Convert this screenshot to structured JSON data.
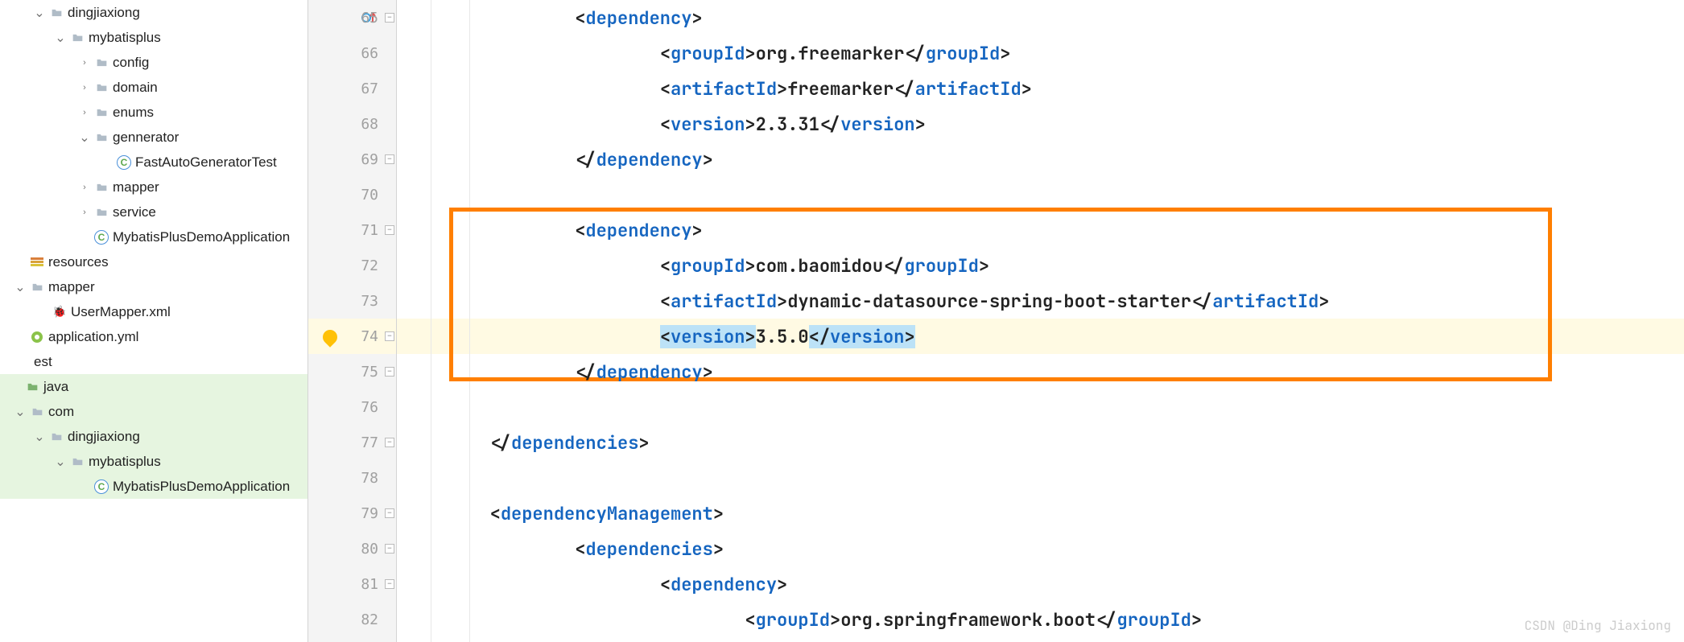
{
  "tree": {
    "items": [
      {
        "indent": 24,
        "arrow": "down",
        "icon": "folder",
        "label": "dingjiaxiong"
      },
      {
        "indent": 50,
        "arrow": "down",
        "icon": "folder",
        "label": "mybatisplus"
      },
      {
        "indent": 80,
        "arrow": "right",
        "icon": "folder",
        "label": "config"
      },
      {
        "indent": 80,
        "arrow": "right",
        "icon": "folder",
        "label": "domain"
      },
      {
        "indent": 80,
        "arrow": "right",
        "icon": "folder",
        "label": "enums"
      },
      {
        "indent": 80,
        "arrow": "down",
        "icon": "folder",
        "label": "gennerator"
      },
      {
        "indent": 108,
        "arrow": "",
        "icon": "java",
        "label": "FastAutoGeneratorTest"
      },
      {
        "indent": 80,
        "arrow": "right",
        "icon": "folder",
        "label": "mapper"
      },
      {
        "indent": 80,
        "arrow": "right",
        "icon": "folder",
        "label": "service"
      },
      {
        "indent": 80,
        "arrow": "",
        "icon": "java",
        "label": "MybatisPlusDemoApplication"
      },
      {
        "indent": 0,
        "arrow": "",
        "icon": "res",
        "label": "resources"
      },
      {
        "indent": 0,
        "arrow": "down",
        "icon": "folder",
        "label": "mapper"
      },
      {
        "indent": 28,
        "arrow": "",
        "icon": "xml",
        "label": "UserMapper.xml"
      },
      {
        "indent": 0,
        "arrow": "",
        "icon": "yml",
        "label": "application.yml"
      },
      {
        "indent": -18,
        "arrow": "",
        "icon": "",
        "label": "est"
      },
      {
        "indent": -6,
        "arrow": "",
        "icon": "folder-g",
        "label": "java",
        "hl": true
      },
      {
        "indent": 0,
        "arrow": "down",
        "icon": "folder",
        "label": "com",
        "hl": true
      },
      {
        "indent": 24,
        "arrow": "down",
        "icon": "folder",
        "label": "dingjiaxiong",
        "hl": true
      },
      {
        "indent": 50,
        "arrow": "down",
        "icon": "folder",
        "label": "mybatisplus",
        "hl": true
      },
      {
        "indent": 80,
        "arrow": "",
        "icon": "java",
        "label": "MybatisPlusDemoApplication",
        "hl": true
      }
    ]
  },
  "gutter": {
    "lines": [
      "65",
      "66",
      "67",
      "68",
      "69",
      "70",
      "71",
      "72",
      "73",
      "74",
      "75",
      "76",
      "77",
      "78",
      "79",
      "80",
      "81",
      "82"
    ]
  },
  "code": {
    "lines": [
      {
        "indent": 4,
        "parts": [
          {
            "t": "<",
            "c": "punct"
          },
          {
            "t": "dependency",
            "c": "tag"
          },
          {
            "t": ">",
            "c": "punct"
          }
        ]
      },
      {
        "indent": 6,
        "parts": [
          {
            "t": "<",
            "c": "punct"
          },
          {
            "t": "groupId",
            "c": "tag"
          },
          {
            "t": ">",
            "c": "punct"
          },
          {
            "t": "org.freemarker",
            "c": "text"
          },
          {
            "t": "</",
            "c": "punct"
          },
          {
            "t": "groupId",
            "c": "tag"
          },
          {
            "t": ">",
            "c": "punct"
          }
        ]
      },
      {
        "indent": 6,
        "parts": [
          {
            "t": "<",
            "c": "punct"
          },
          {
            "t": "artifactId",
            "c": "tag"
          },
          {
            "t": ">",
            "c": "punct"
          },
          {
            "t": "freemarker",
            "c": "text"
          },
          {
            "t": "</",
            "c": "punct"
          },
          {
            "t": "artifactId",
            "c": "tag"
          },
          {
            "t": ">",
            "c": "punct"
          }
        ]
      },
      {
        "indent": 6,
        "parts": [
          {
            "t": "<",
            "c": "punct"
          },
          {
            "t": "version",
            "c": "tag"
          },
          {
            "t": ">",
            "c": "punct"
          },
          {
            "t": "2.3.31",
            "c": "text"
          },
          {
            "t": "</",
            "c": "punct"
          },
          {
            "t": "version",
            "c": "tag"
          },
          {
            "t": ">",
            "c": "punct"
          }
        ]
      },
      {
        "indent": 4,
        "parts": [
          {
            "t": "</",
            "c": "punct"
          },
          {
            "t": "dependency",
            "c": "tag"
          },
          {
            "t": ">",
            "c": "punct"
          }
        ]
      },
      {
        "indent": 0,
        "parts": []
      },
      {
        "indent": 4,
        "parts": [
          {
            "t": "<",
            "c": "punct"
          },
          {
            "t": "dependency",
            "c": "tag"
          },
          {
            "t": ">",
            "c": "punct"
          }
        ]
      },
      {
        "indent": 6,
        "parts": [
          {
            "t": "<",
            "c": "punct"
          },
          {
            "t": "groupId",
            "c": "tag"
          },
          {
            "t": ">",
            "c": "punct"
          },
          {
            "t": "com.baomidou",
            "c": "text"
          },
          {
            "t": "</",
            "c": "punct"
          },
          {
            "t": "groupId",
            "c": "tag"
          },
          {
            "t": ">",
            "c": "punct"
          }
        ]
      },
      {
        "indent": 6,
        "parts": [
          {
            "t": "<",
            "c": "punct"
          },
          {
            "t": "artifactId",
            "c": "tag"
          },
          {
            "t": ">",
            "c": "punct"
          },
          {
            "t": "dynamic-datasource-spring-boot-starter",
            "c": "text"
          },
          {
            "t": "</",
            "c": "punct"
          },
          {
            "t": "artifactId",
            "c": "tag"
          },
          {
            "t": ">",
            "c": "punct"
          }
        ]
      },
      {
        "indent": 6,
        "parts": [
          {
            "t": "<",
            "c": "punct sel"
          },
          {
            "t": "version",
            "c": "tag sel"
          },
          {
            "t": ">",
            "c": "punct sel"
          },
          {
            "t": "3.5.0",
            "c": "text"
          },
          {
            "t": "<",
            "c": "punct sel"
          },
          {
            "t": "/",
            "c": "punct sel"
          },
          {
            "t": "version",
            "c": "tag sel"
          },
          {
            "t": ">",
            "c": "punct sel"
          }
        ],
        "current": true
      },
      {
        "indent": 4,
        "parts": [
          {
            "t": "</",
            "c": "punct"
          },
          {
            "t": "dependency",
            "c": "tag"
          },
          {
            "t": ">",
            "c": "punct"
          }
        ]
      },
      {
        "indent": 0,
        "parts": []
      },
      {
        "indent": 2,
        "parts": [
          {
            "t": "</",
            "c": "punct"
          },
          {
            "t": "dependencies",
            "c": "tag"
          },
          {
            "t": ">",
            "c": "punct"
          }
        ]
      },
      {
        "indent": 0,
        "parts": []
      },
      {
        "indent": 2,
        "parts": [
          {
            "t": "<",
            "c": "punct"
          },
          {
            "t": "dependencyManagement",
            "c": "tag"
          },
          {
            "t": ">",
            "c": "punct"
          }
        ]
      },
      {
        "indent": 4,
        "parts": [
          {
            "t": "<",
            "c": "punct"
          },
          {
            "t": "dependencies",
            "c": "tag"
          },
          {
            "t": ">",
            "c": "punct"
          }
        ]
      },
      {
        "indent": 6,
        "parts": [
          {
            "t": "<",
            "c": "punct"
          },
          {
            "t": "dependency",
            "c": "tag"
          },
          {
            "t": ">",
            "c": "punct"
          }
        ]
      },
      {
        "indent": 8,
        "parts": [
          {
            "t": "<",
            "c": "punct"
          },
          {
            "t": "groupId",
            "c": "tag"
          },
          {
            "t": ">",
            "c": "punct"
          },
          {
            "t": "org.springframework.boot",
            "c": "text"
          },
          {
            "t": "</",
            "c": "punct"
          },
          {
            "t": "groupId",
            "c": "tag"
          },
          {
            "t": ">",
            "c": "punct"
          }
        ]
      }
    ]
  },
  "watermark": "CSDN @Ding Jiaxiong"
}
